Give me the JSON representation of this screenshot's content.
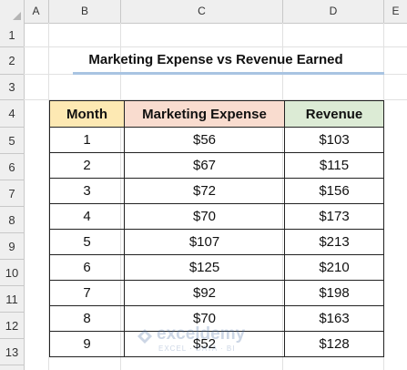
{
  "sheet": {
    "columns": [
      "A",
      "B",
      "C",
      "D",
      "E"
    ],
    "rows": [
      "1",
      "2",
      "3",
      "4",
      "5",
      "6",
      "7",
      "8",
      "9",
      "10",
      "11",
      "12",
      "13"
    ]
  },
  "title": "Marketing Expense vs Revenue Earned",
  "table": {
    "headers": [
      "Month",
      "Marketing Expense",
      "Revenue"
    ],
    "rows": [
      [
        "1",
        "$56",
        "$103"
      ],
      [
        "2",
        "$67",
        "$115"
      ],
      [
        "3",
        "$72",
        "$156"
      ],
      [
        "4",
        "$70",
        "$173"
      ],
      [
        "5",
        "$107",
        "$213"
      ],
      [
        "6",
        "$125",
        "$210"
      ],
      [
        "7",
        "$92",
        "$198"
      ],
      [
        "8",
        "$70",
        "$163"
      ],
      [
        "9",
        "$52",
        "$128"
      ]
    ]
  },
  "watermark": {
    "name": "exceldemy",
    "tagline": "EXCEL · DATA · BI"
  },
  "colors": {
    "month_header": "#fde9b3",
    "expense_header": "#f9dccf",
    "revenue_header": "#dcebd5",
    "title_underline": "#a9c4e2"
  }
}
